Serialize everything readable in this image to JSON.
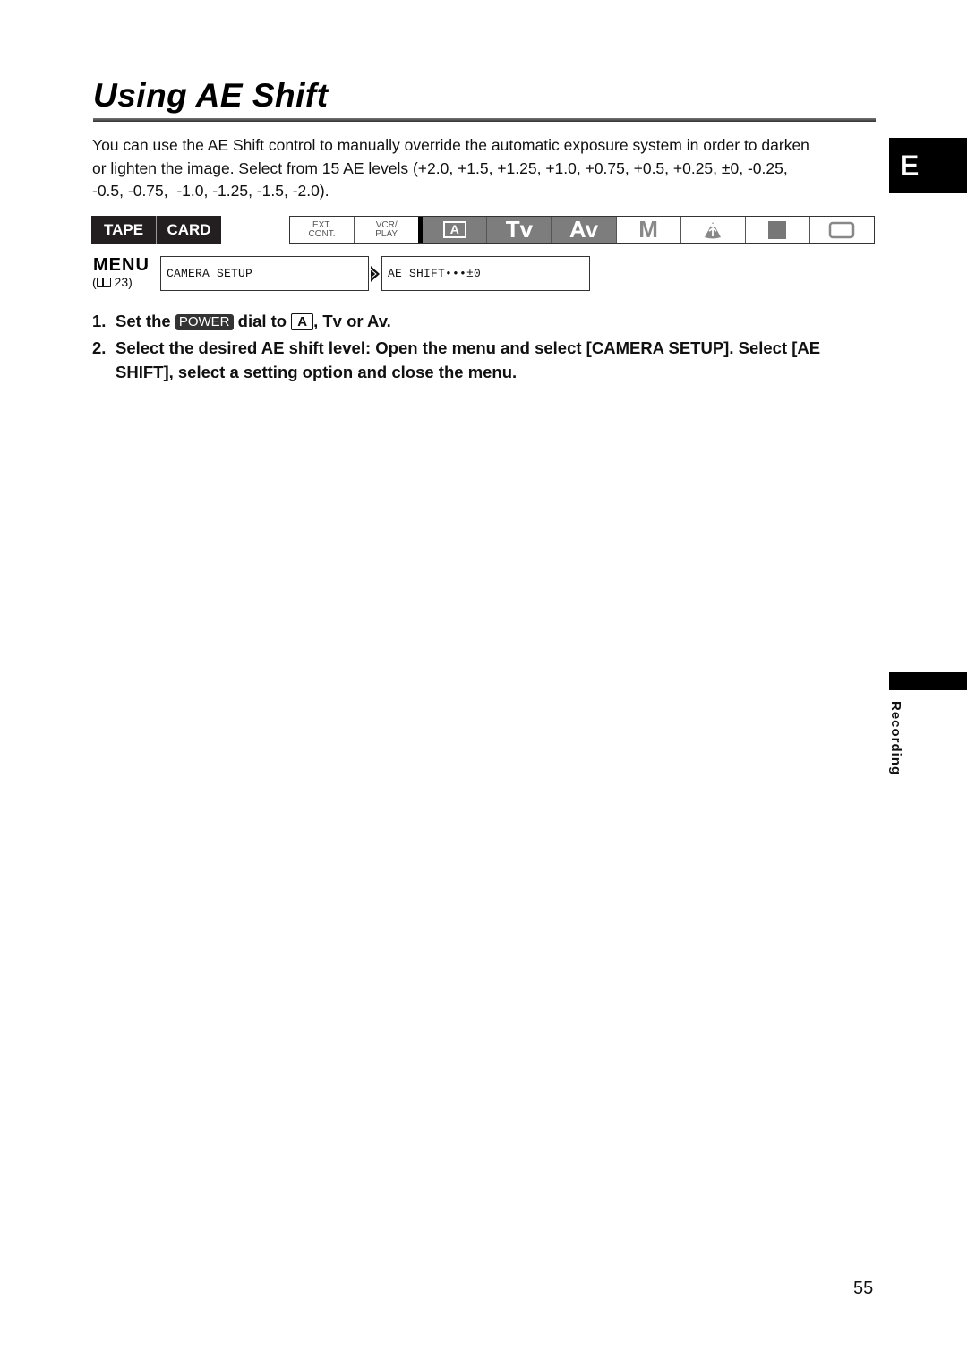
{
  "page": {
    "title": "Using AE Shift",
    "language_tab": "E",
    "section_label": "Recording",
    "page_number": "55"
  },
  "intro": {
    "lines": [
      "You can use the AE Shift control to manually override the automatic exposure system in order to darken",
      "or lighten the image. Select from 15 AE levels (+2.0, +1.5, +1.25, +1.0, +0.75, +0.5, +0.25, ±0, -0.25,",
      "-0.5, -0.75,  -1.0, -1.25, -1.5, -2.0)."
    ]
  },
  "media": {
    "items": [
      {
        "label": "TAPE",
        "active": true
      },
      {
        "label": "CARD",
        "active": true
      }
    ]
  },
  "modes": {
    "items": [
      {
        "label_top": "EXT.",
        "label_bottom": "CONT.",
        "icon": "ext-cont",
        "active": false
      },
      {
        "label_top": "VCR/",
        "label_bottom": "PLAY",
        "icon": "vcr-play",
        "active": false
      },
      {
        "label": "A",
        "icon": "auto-mode-icon",
        "active": true
      },
      {
        "label": "Tv",
        "icon": "tv-mode",
        "active": true
      },
      {
        "label": "Av",
        "icon": "av-mode",
        "active": true
      },
      {
        "label": "M",
        "icon": "manual-mode",
        "active": false
      },
      {
        "icon": "spotlight-icon",
        "active": false
      },
      {
        "icon": "night-moon-icon",
        "active": false
      },
      {
        "icon": "frame-rectangle-icon",
        "active": false
      }
    ]
  },
  "menu": {
    "label": "MENU",
    "ref_prefix": "(",
    "ref_page": " 23)",
    "path": [
      "CAMERA SETUP",
      "AE SHIFT•••±0"
    ]
  },
  "steps": [
    {
      "num": "1.",
      "parts": {
        "a": "Set the ",
        "power": "POWER",
        "b": " dial to ",
        "mode_a": "A",
        "c": ", Tv or Av."
      }
    },
    {
      "num": "2.",
      "text": "Select the desired AE shift level: Open the menu and select [CAMERA SETUP]. Select [AE SHIFT], select a setting option and close the menu."
    }
  ]
}
